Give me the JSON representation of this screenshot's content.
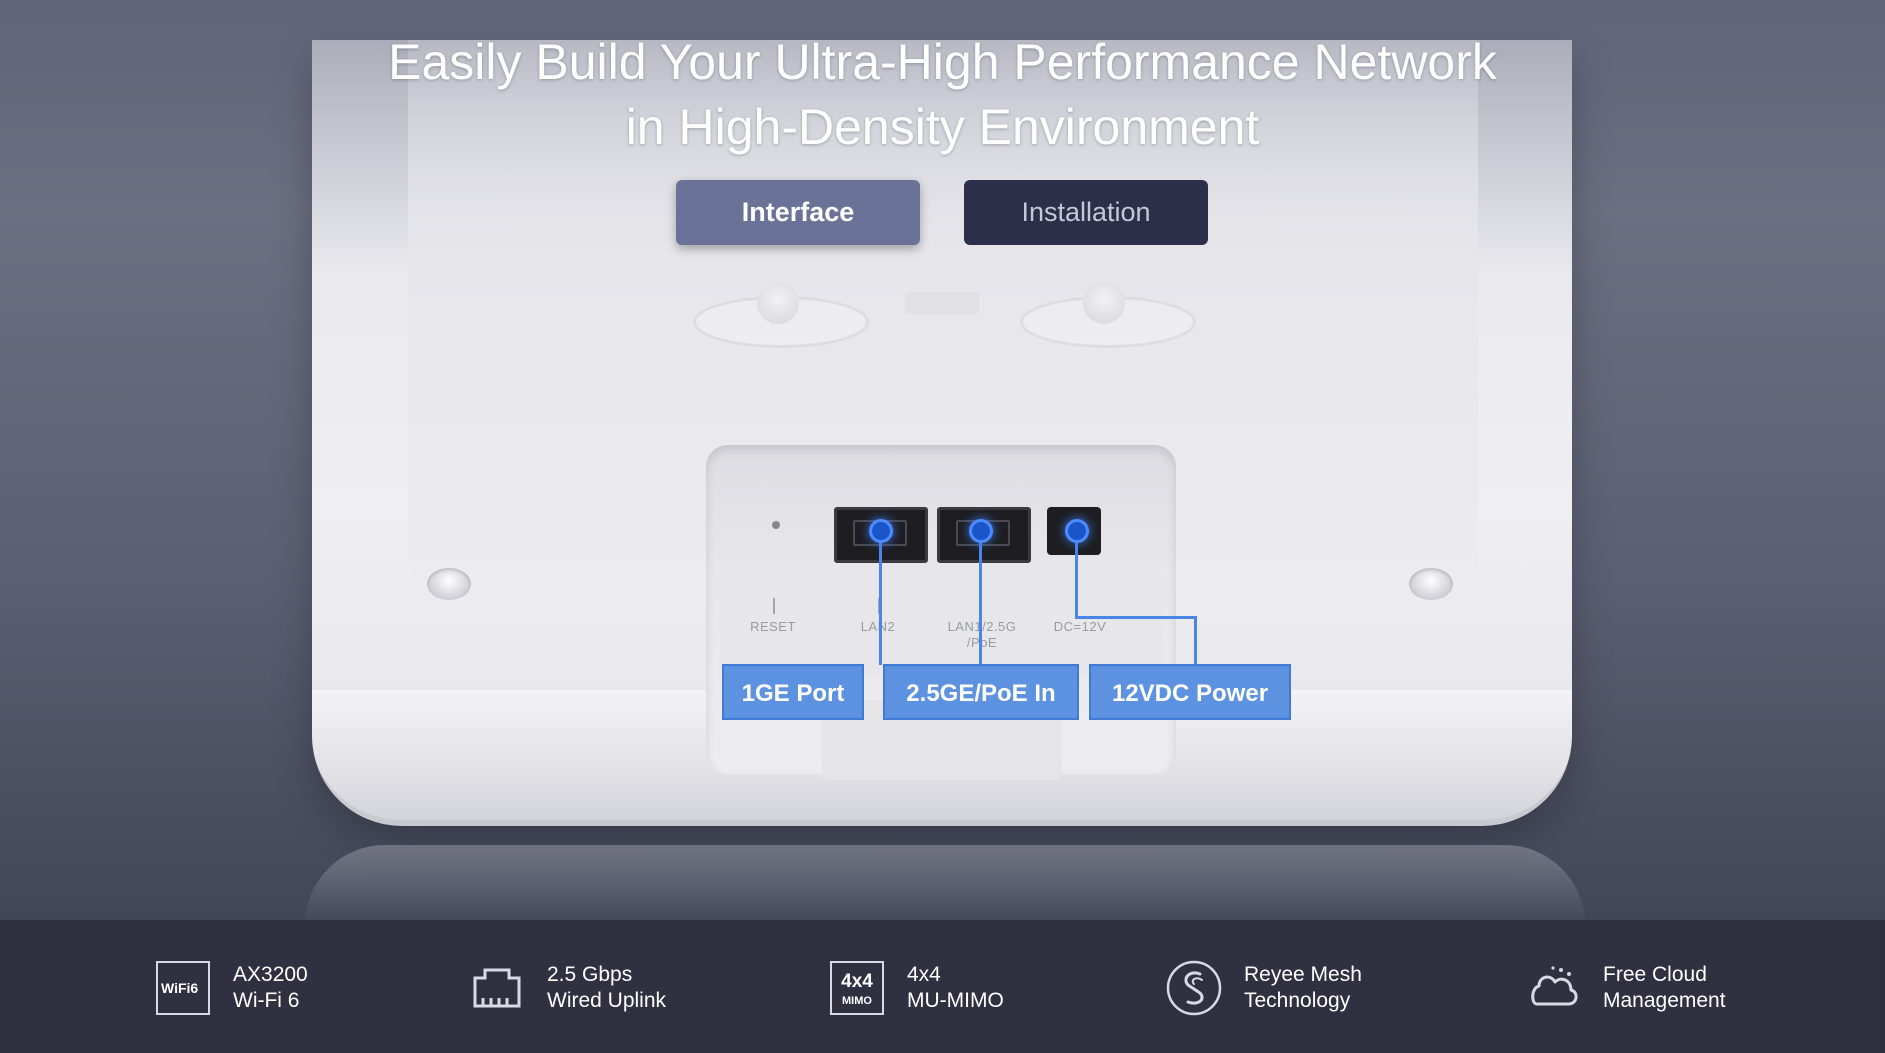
{
  "headline": {
    "line1": "Easily Build Your Ultra-High Performance Network",
    "line2": "in High-Density Environment"
  },
  "tabs": [
    {
      "label": "Interface",
      "active": true
    },
    {
      "label": "Installation",
      "active": false
    }
  ],
  "device": {
    "silkscreen": {
      "reset": "RESET",
      "lan2": "LAN2",
      "lan1_line1": "LAN1/2.5G",
      "lan1_line2": "/PoE",
      "dc": "DC=12V"
    },
    "callouts": [
      "1GE Port",
      "2.5GE/PoE In",
      "12VDC Power"
    ]
  },
  "features": [
    {
      "icon": "wifi6-icon",
      "icon_text": "WiFi6",
      "line1": "AX3200",
      "line2": "Wi-Fi 6"
    },
    {
      "icon": "ethernet-port-icon",
      "line1": "2.5 Gbps",
      "line2": "Wired Uplink"
    },
    {
      "icon": "mimo-icon",
      "icon_text_top": "4x4",
      "icon_text_bottom": "MIMO",
      "line1": "4x4",
      "line2": "MU-MIMO"
    },
    {
      "icon": "reyee-mesh-icon",
      "line1": "Reyee Mesh",
      "line2": "Technology"
    },
    {
      "icon": "cloud-icon",
      "line1": "Free Cloud",
      "line2": "Management"
    }
  ],
  "colors": {
    "accent_blue": "#5c92e0",
    "tab_active": "#6b7297",
    "tab_inactive": "#2c2f4a",
    "feature_bar": "#2f3140"
  }
}
